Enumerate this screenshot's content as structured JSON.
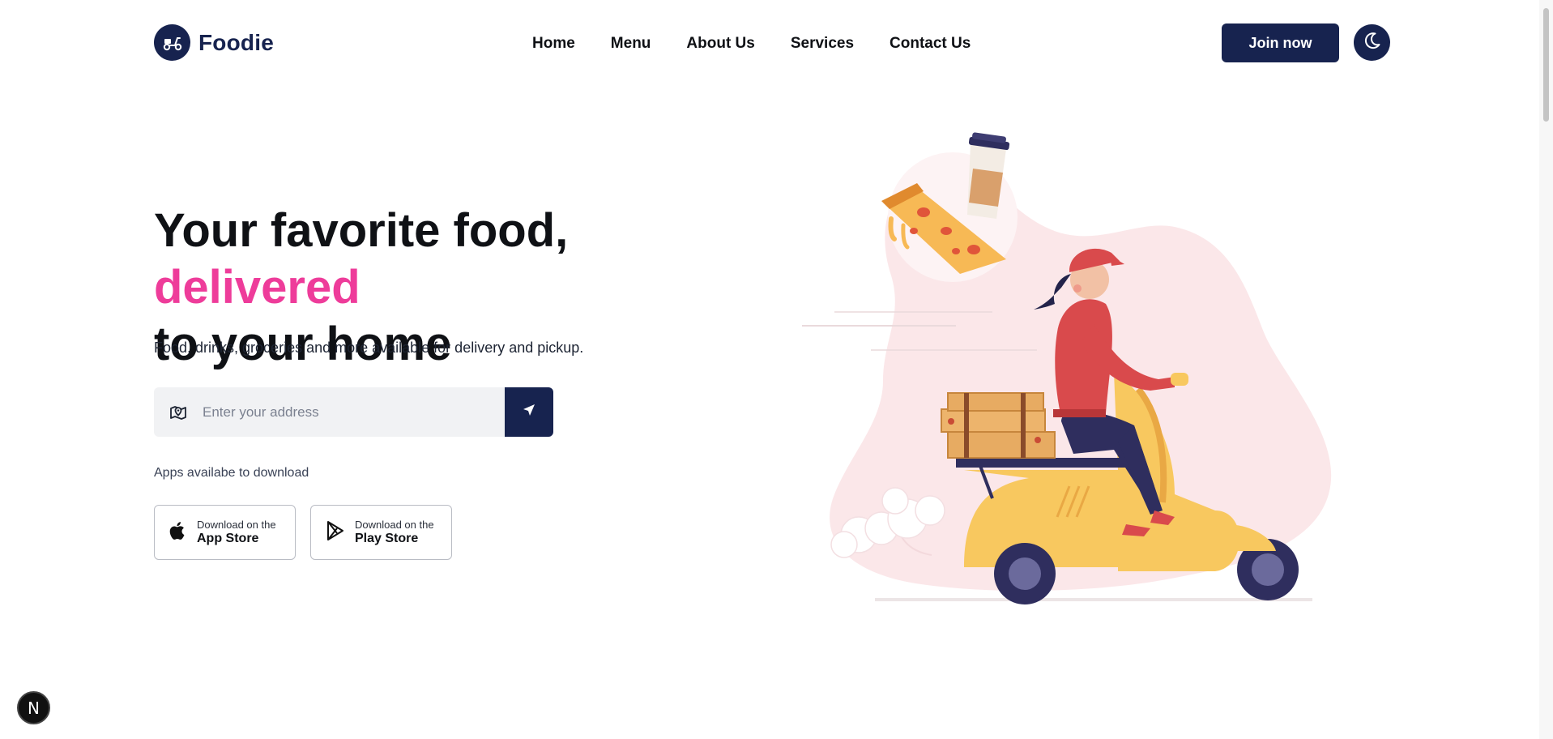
{
  "brand": {
    "name": "Foodie",
    "icon": "scooter-icon"
  },
  "nav": {
    "items": [
      {
        "label": "Home"
      },
      {
        "label": "Menu"
      },
      {
        "label": "About Us"
      },
      {
        "label": "Services"
      },
      {
        "label": "Contact Us"
      }
    ]
  },
  "header": {
    "join_label": "Join now",
    "theme_icon": "moon-icon"
  },
  "hero": {
    "title_part1": "Your favorite food, ",
    "title_accent": "delivered",
    "title_part2": "to your home",
    "subtitle": "Food, drinks, groceries and more available for delivery and pickup."
  },
  "search": {
    "placeholder": "Enter your address",
    "value": ""
  },
  "apps": {
    "label": "Apps availabe to download",
    "stores": [
      {
        "small": "Download on the",
        "big": "App Store",
        "icon": "apple-icon"
      },
      {
        "small": "Download on the",
        "big": "Play Store",
        "icon": "play-store-icon"
      }
    ]
  },
  "colors": {
    "brand": "#17234f",
    "accent": "#ee3c9a",
    "blob": "#f9e3e6"
  },
  "next_badge": "N"
}
